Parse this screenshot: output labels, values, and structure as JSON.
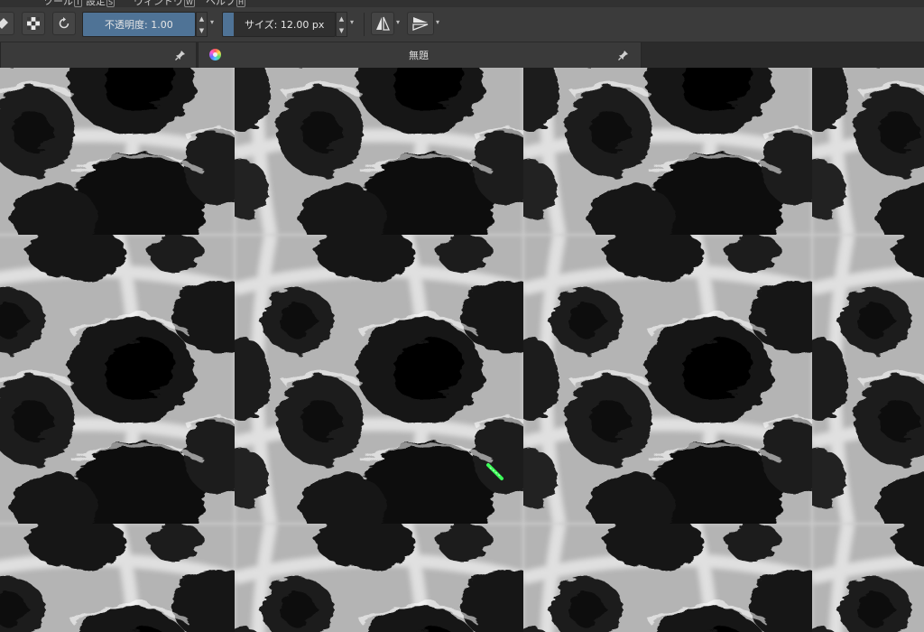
{
  "menubar": {
    "items": [
      {
        "label": "ツール",
        "accel": "T"
      },
      {
        "label": "設定",
        "accel": "S"
      },
      {
        "label": "ウィンドウ",
        "accel": "W"
      },
      {
        "label": "ヘルプ",
        "accel": "H"
      }
    ]
  },
  "toolbar": {
    "opacity_slider": {
      "label": "不透明度:",
      "value": "1.00",
      "fill": 1.0
    },
    "size_slider": {
      "label": "サイズ:",
      "value": "12.00 px",
      "fill": 0.1
    }
  },
  "tabs": [
    {
      "title": ""
    },
    {
      "title": "無題"
    }
  ],
  "canvas": {
    "pattern": "seamless-dark-cell-texture"
  },
  "colors": {
    "accent": "#4f7396",
    "toolbar_bg": "#3b3b3b",
    "tab_bg": "#3a3a3a",
    "cursor": "#3dff5a"
  }
}
